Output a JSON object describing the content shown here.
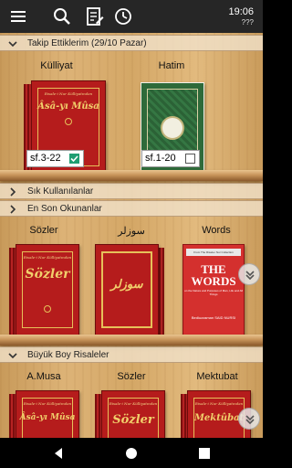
{
  "status": {
    "time": "19:06",
    "date": "???"
  },
  "toolbar": {
    "icons": [
      "menu-icon",
      "search-icon",
      "notes-icon",
      "history-icon"
    ]
  },
  "sections": {
    "followed": {
      "label": "Takip Ettiklerim  (29/10 Pazar)",
      "expanded": true
    },
    "frequent": {
      "label": "Sık Kullanılanlar",
      "expanded": false
    },
    "recent": {
      "label": "En Son Okunanlar",
      "expanded": false
    },
    "large": {
      "label": "Büyük Boy Risaleler",
      "expanded": true
    }
  },
  "followed_books": [
    {
      "label": "Külliyat",
      "cover_title": "Âsâ-yı Mûsa",
      "series": "Risale-i Nur Külliyatından",
      "progress": "sf.3-22",
      "checked": true
    },
    {
      "label": "Hatim",
      "progress": "sf.1-20",
      "checked": false
    }
  ],
  "shelf2_books": [
    {
      "label": "Sözler",
      "cover_title": "Sözler",
      "series": "Risale-i Nur Külliyatından"
    },
    {
      "label": "سوزلر",
      "cover_title": "سوزلر"
    },
    {
      "label": "Words",
      "cover_title": "THE WORDS",
      "series": "From The Risale-i Nur Collection",
      "subtitle": "on the Nature and Purposes of Man, Life and All Things",
      "author": "Bediuzzaman SAID NURSI"
    }
  ],
  "shelf3_books": [
    {
      "label": "A.Musa",
      "cover_title": "Âsâ-yı Mûsa",
      "series": "Risale-i Nur Külliyatından"
    },
    {
      "label": "Sözler",
      "cover_title": "Sözler",
      "series": "Risale-i Nur Külliyatından"
    },
    {
      "label": "Mektubat",
      "cover_title": "Mektûbat",
      "series": "Risale-i Nur Külliyatından"
    }
  ],
  "colors": {
    "toolbar": "#262626",
    "book_red": "#b51c1c",
    "book_gold": "#f1cf6b",
    "check_green": "#1f9e72"
  }
}
